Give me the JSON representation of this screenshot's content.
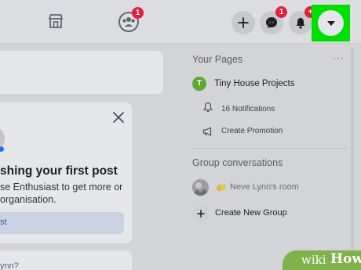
{
  "topbar": {
    "groups_badge": "1",
    "messenger_badge": "1",
    "notifications_badge": "+",
    "highlight_color": "#00e000"
  },
  "icons": {
    "marketplace": "store-icon",
    "groups": "groups-icon",
    "create": "plus-icon",
    "messenger": "messenger-icon",
    "notifications": "bell-icon",
    "account": "caret-down-icon"
  },
  "feed": {
    "post_card": {
      "heading": "shing your first post",
      "body": "se Enthusiast to get more or organisation.",
      "button_label": "st"
    },
    "bottom_text": "ynn?"
  },
  "sidebar": {
    "your_pages": {
      "title": "Your Pages",
      "more": "···",
      "page": {
        "initial": "T",
        "name": "Tiny House Projects",
        "notifications": "16 Notifications",
        "promotion": "Create Promotion"
      }
    },
    "group_conversations": {
      "title": "Group conversations",
      "room": "Neve Lynn's room",
      "create_new": "Create New Group"
    }
  },
  "watermark": {
    "wiki": "wiki",
    "how": "How"
  }
}
